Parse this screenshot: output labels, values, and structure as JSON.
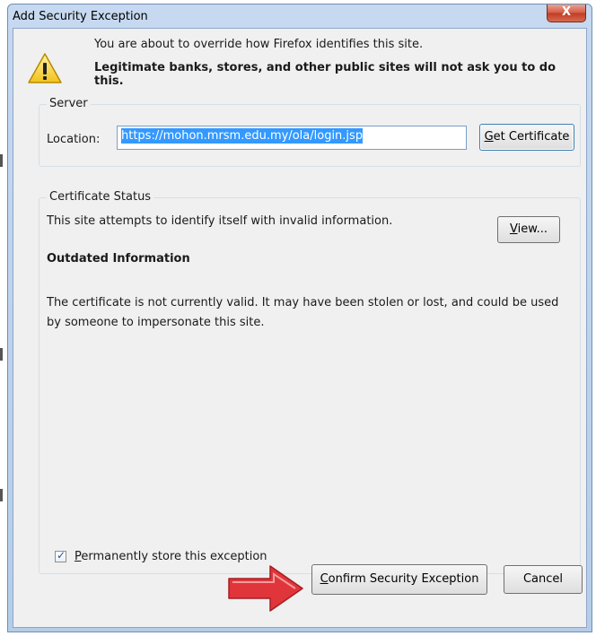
{
  "window": {
    "title": "Add Security Exception",
    "close_glyph": "X"
  },
  "intro": {
    "line1": "You are about to override how Firefox identifies this site.",
    "line2": "Legitimate banks, stores, and other public sites will not ask you to do this.",
    "icon": "warning-triangle-icon"
  },
  "server": {
    "group_label": "Server",
    "location_label": "Location:",
    "location_value": "https://mohon.mrsm.edu.my/ola/login.jsp",
    "get_certificate_label": "Get Certificate"
  },
  "certificate_status": {
    "group_label": "Certificate Status",
    "status_line": "This site attempts to identify itself with invalid information.",
    "view_label": "View...",
    "heading": "Outdated Information",
    "description": "The certificate is not currently valid. It may have been stolen or lost, and could be used by someone to impersonate this site."
  },
  "store": {
    "checked": true,
    "label": "Permanently store this exception"
  },
  "buttons": {
    "confirm_label": "Confirm Security Exception",
    "cancel_label": "Cancel"
  },
  "annotation": {
    "arrow_icon": "red-arrow-icon",
    "arrow_color": "#e0353b"
  }
}
